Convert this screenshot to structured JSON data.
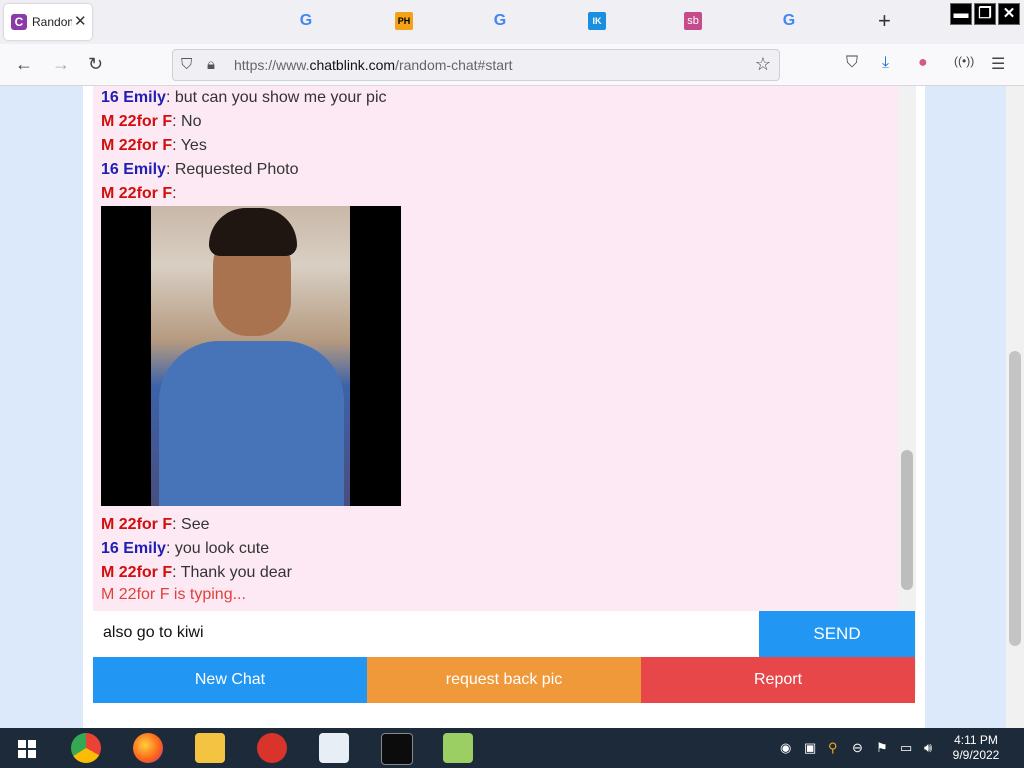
{
  "browser": {
    "active_tab_title": "Random Chat",
    "active_tab_favicon": "C",
    "pinned_tabs": [
      "G",
      "PH",
      "G",
      "IK",
      "sb",
      "G"
    ],
    "url_prefix": "https://www.",
    "url_domain": "chatblink.com",
    "url_path": "/random-chat#start"
  },
  "chat": {
    "messages": [
      {
        "name": "16 Emily",
        "text": ": but can you show me your pic",
        "color": "blue"
      },
      {
        "name": "M 22for F",
        "text": ": No",
        "color": "red"
      },
      {
        "name": "M 22for F",
        "text": ": Yes",
        "color": "red"
      },
      {
        "name": "16 Emily",
        "text": ": Requested Photo",
        "color": "blue"
      },
      {
        "name": "M 22for F",
        "text": ":",
        "color": "red"
      },
      {
        "name": "M 22for F",
        "text": ": See",
        "color": "red"
      },
      {
        "name": "16 Emily",
        "text": ": you look cute",
        "color": "blue"
      },
      {
        "name": "M 22for F",
        "text": ": Thank you dear",
        "color": "red"
      }
    ],
    "typing_status": "M 22for F is typing...",
    "input_value": "also go to kiwi",
    "send_label": "SEND",
    "buttons": {
      "new_chat": "New Chat",
      "request_pic": "request back pic",
      "report": "Report"
    },
    "colors": {
      "new_chat": "#2196f3",
      "request_pic": "#f0993a",
      "report": "#e8474a"
    }
  },
  "taskbar": {
    "time": "4:11 PM",
    "date": "9/9/2022"
  }
}
